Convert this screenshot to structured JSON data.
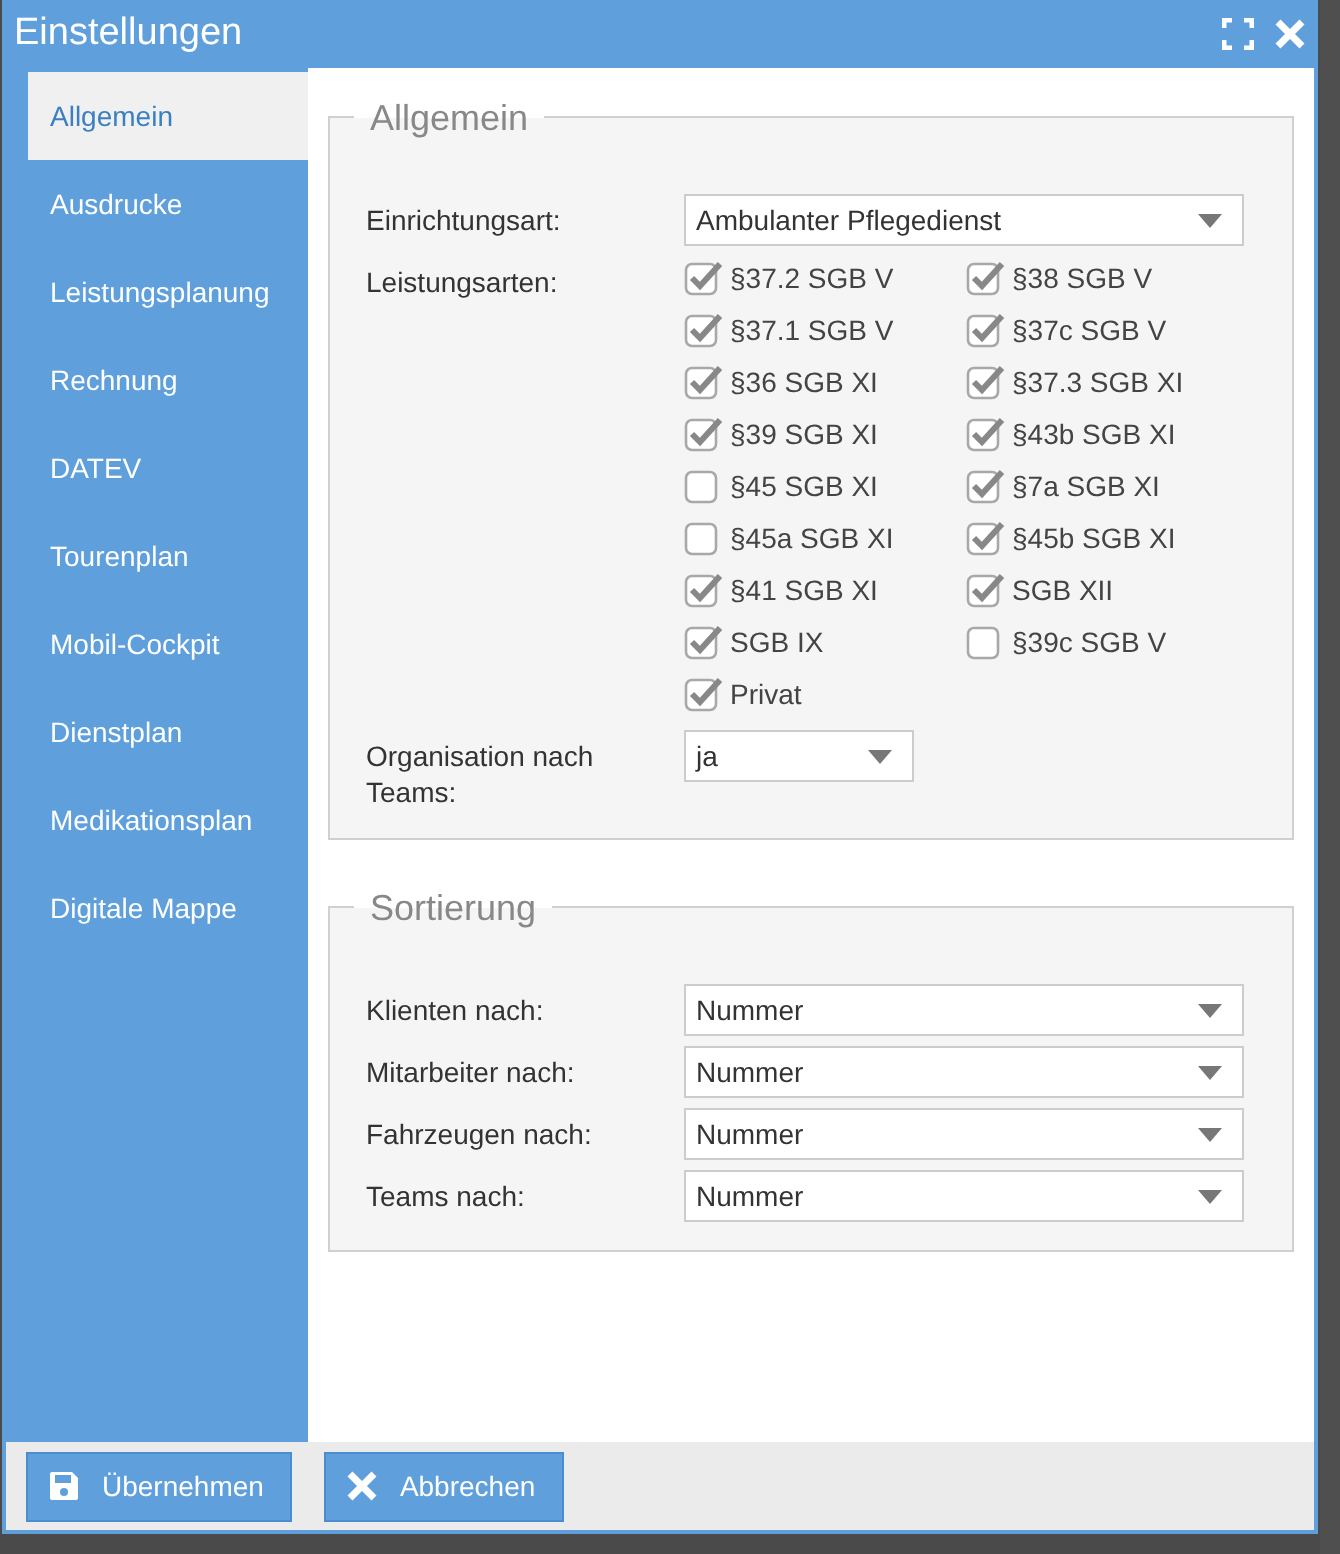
{
  "window": {
    "title": "Einstellungen"
  },
  "sidebar": {
    "items": [
      {
        "label": "Allgemein",
        "selected": true
      },
      {
        "label": "Ausdrucke",
        "selected": false
      },
      {
        "label": "Leistungsplanung",
        "selected": false
      },
      {
        "label": "Rechnung",
        "selected": false
      },
      {
        "label": "DATEV",
        "selected": false
      },
      {
        "label": "Tourenplan",
        "selected": false
      },
      {
        "label": "Mobil-Cockpit",
        "selected": false
      },
      {
        "label": "Dienstplan",
        "selected": false
      },
      {
        "label": "Medikationsplan",
        "selected": false
      },
      {
        "label": "Digitale Mappe",
        "selected": false
      }
    ]
  },
  "sections": [
    {
      "legend": "Allgemein",
      "fields": [
        {
          "kind": "select",
          "label": "Einrichtungsart:",
          "value": "Ambulanter Pflegedienst"
        },
        {
          "kind": "checkboxes",
          "label": "Leistungsarten:",
          "options": [
            {
              "label": "§37.2 SGB V",
              "checked": true
            },
            {
              "label": "§38 SGB V",
              "checked": true
            },
            {
              "label": "§37.1 SGB V",
              "checked": true
            },
            {
              "label": "§37c SGB V",
              "checked": true
            },
            {
              "label": "§36 SGB XI",
              "checked": true
            },
            {
              "label": "§37.3 SGB XI",
              "checked": true
            },
            {
              "label": "§39 SGB XI",
              "checked": true
            },
            {
              "label": "§43b SGB XI",
              "checked": true
            },
            {
              "label": "§45 SGB XI",
              "checked": false
            },
            {
              "label": "§7a SGB XI",
              "checked": true
            },
            {
              "label": "§45a SGB XI",
              "checked": false
            },
            {
              "label": "§45b SGB XI",
              "checked": true
            },
            {
              "label": "§41 SGB XI",
              "checked": true
            },
            {
              "label": "SGB XII",
              "checked": true
            },
            {
              "label": "SGB IX",
              "checked": true
            },
            {
              "label": "§39c SGB V",
              "checked": false
            },
            {
              "label": "Privat",
              "checked": true
            }
          ]
        },
        {
          "kind": "short_select",
          "label": "Organisation nach Teams:",
          "value": "ja"
        }
      ]
    },
    {
      "legend": "Sortierung",
      "fields": [
        {
          "kind": "select",
          "label": "Klienten nach:",
          "value": "Nummer"
        },
        {
          "kind": "select",
          "label": "Mitarbeiter nach:",
          "value": "Nummer"
        },
        {
          "kind": "select",
          "label": "Fahrzeugen nach:",
          "value": "Nummer"
        },
        {
          "kind": "select",
          "label": "Teams nach:",
          "value": "Nummer"
        }
      ]
    }
  ],
  "buttons": [
    {
      "label": "Übernehmen",
      "kind": "save"
    },
    {
      "label": "Abbrechen",
      "kind": "cancel"
    }
  ]
}
